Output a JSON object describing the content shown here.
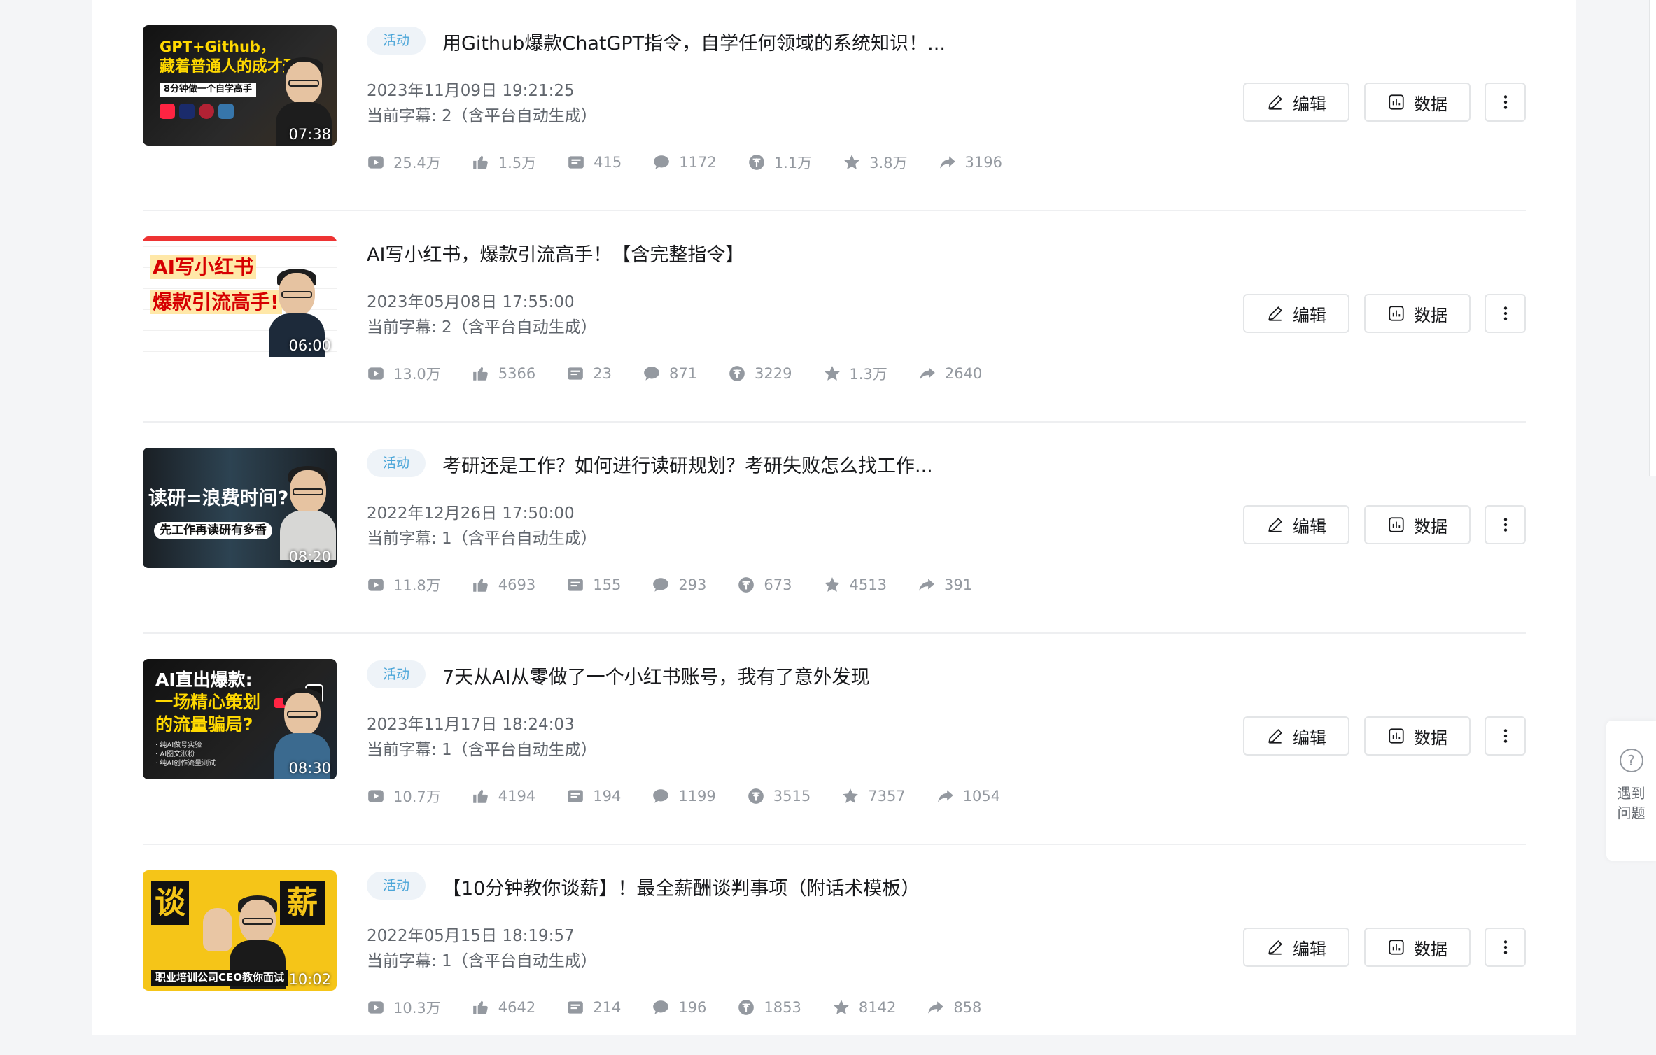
{
  "labels": {
    "badge": "活动",
    "edit": "编辑",
    "data": "数据",
    "help": "遇到问题",
    "help_mark": "?"
  },
  "videos": [
    {
      "title": "用Github爆款ChatGPT指令，自学任何领域的系统知识！...",
      "has_badge": true,
      "date": "2023年11月09日 19:21:25",
      "subtitle": "当前字幕: 2（含平台自动生成）",
      "duration": "07:38",
      "thumb_lines": [
        "GPT+Github，",
        "藏着普通人的成才圣经",
        "8分钟做一个自学高手"
      ],
      "stats": {
        "views": "25.4万",
        "likes": "1.5万",
        "danmaku": "415",
        "comments": "1172",
        "coins": "1.1万",
        "favorites": "3.8万",
        "shares": "3196"
      }
    },
    {
      "title": "AI写小红书，爆款引流高手！【含完整指令】",
      "has_badge": false,
      "date": "2023年05月08日 17:55:00",
      "subtitle": "当前字幕: 2（含平台自动生成）",
      "duration": "06:00",
      "thumb_lines": [
        "AI写小红书",
        "爆款引流高手!"
      ],
      "stats": {
        "views": "13.0万",
        "likes": "5366",
        "danmaku": "23",
        "comments": "871",
        "coins": "3229",
        "favorites": "1.3万",
        "shares": "2640"
      }
    },
    {
      "title": "考研还是工作？如何进行读研规划？考研失败怎么找工作...",
      "has_badge": true,
      "date": "2022年12月26日 17:50:00",
      "subtitle": "当前字幕: 1（含平台自动生成）",
      "duration": "08:20",
      "thumb_lines": [
        "读研=浪费时间?",
        "先工作再读研有多香"
      ],
      "stats": {
        "views": "11.8万",
        "likes": "4693",
        "danmaku": "155",
        "comments": "293",
        "coins": "673",
        "favorites": "4513",
        "shares": "391"
      }
    },
    {
      "title": "7天从AI从零做了一个小红书账号，我有了意外发现",
      "has_badge": true,
      "date": "2023年11月17日 18:24:03",
      "subtitle": "当前字幕: 1（含平台自动生成）",
      "duration": "08:30",
      "thumb_lines": [
        "AI直出爆款:",
        "一场精心策划",
        "的流量骗局?",
        "· 纯AI做号实验",
        "· AI图文涨粉",
        "· 纯AI创作流量测试"
      ],
      "stats": {
        "views": "10.7万",
        "likes": "4194",
        "danmaku": "194",
        "comments": "1199",
        "coins": "3515",
        "favorites": "7357",
        "shares": "1054"
      }
    },
    {
      "title": "【10分钟教你谈薪】！最全薪酬谈判事项（附话术模板）",
      "has_badge": true,
      "date": "2022年05月15日 18:19:57",
      "subtitle": "当前字幕: 1（含平台自动生成）",
      "duration": "10:02",
      "thumb_lines": [
        "谈",
        "薪",
        "职业培训公司CEO教你面试"
      ],
      "stats": {
        "views": "10.3万",
        "likes": "4642",
        "danmaku": "214",
        "comments": "196",
        "coins": "1853",
        "favorites": "8142",
        "shares": "858"
      }
    }
  ],
  "colors": {
    "accent": "#4aa5d8",
    "badge_bg": "#eef3f8",
    "thumb_yellow": "#f5c518",
    "thumb_highlight": "#ffd800"
  }
}
